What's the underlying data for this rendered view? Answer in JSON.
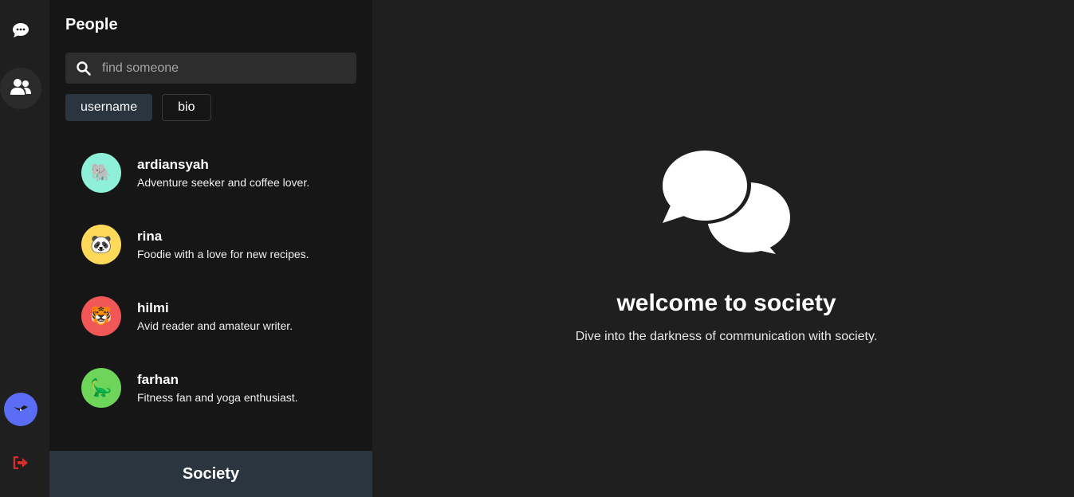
{
  "rail": {
    "chat_icon": "chat-bubble-icon",
    "people_icon": "users-icon",
    "avatar_color": "#5b6cf5",
    "logout_icon": "logout-icon",
    "logout_color": "#d32f2f"
  },
  "panel": {
    "title": "People",
    "search": {
      "placeholder": "find someone",
      "value": ""
    },
    "filters": [
      {
        "label": "username",
        "active": true
      },
      {
        "label": "bio",
        "active": false
      }
    ],
    "people": [
      {
        "name": "ardiansyah",
        "bio": "Adventure seeker and coffee lover.",
        "avatar_emoji": "🐘",
        "avatar_color": "#8ef0d8"
      },
      {
        "name": "rina",
        "bio": "Foodie with a love for new recipes.",
        "avatar_emoji": "🐼",
        "avatar_color": "#ffd95a"
      },
      {
        "name": "hilmi",
        "bio": "Avid reader and amateur writer.",
        "avatar_emoji": "🐯",
        "avatar_color": "#f25757"
      },
      {
        "name": "farhan",
        "bio": "Fitness fan and yoga enthusiast.",
        "avatar_emoji": "🦕",
        "avatar_color": "#6fd45a"
      }
    ],
    "brand": "Society"
  },
  "main": {
    "hero_icon": "comments-icon",
    "welcome": "welcome to society",
    "subtitle": "Dive into the darkness of communication with society."
  }
}
